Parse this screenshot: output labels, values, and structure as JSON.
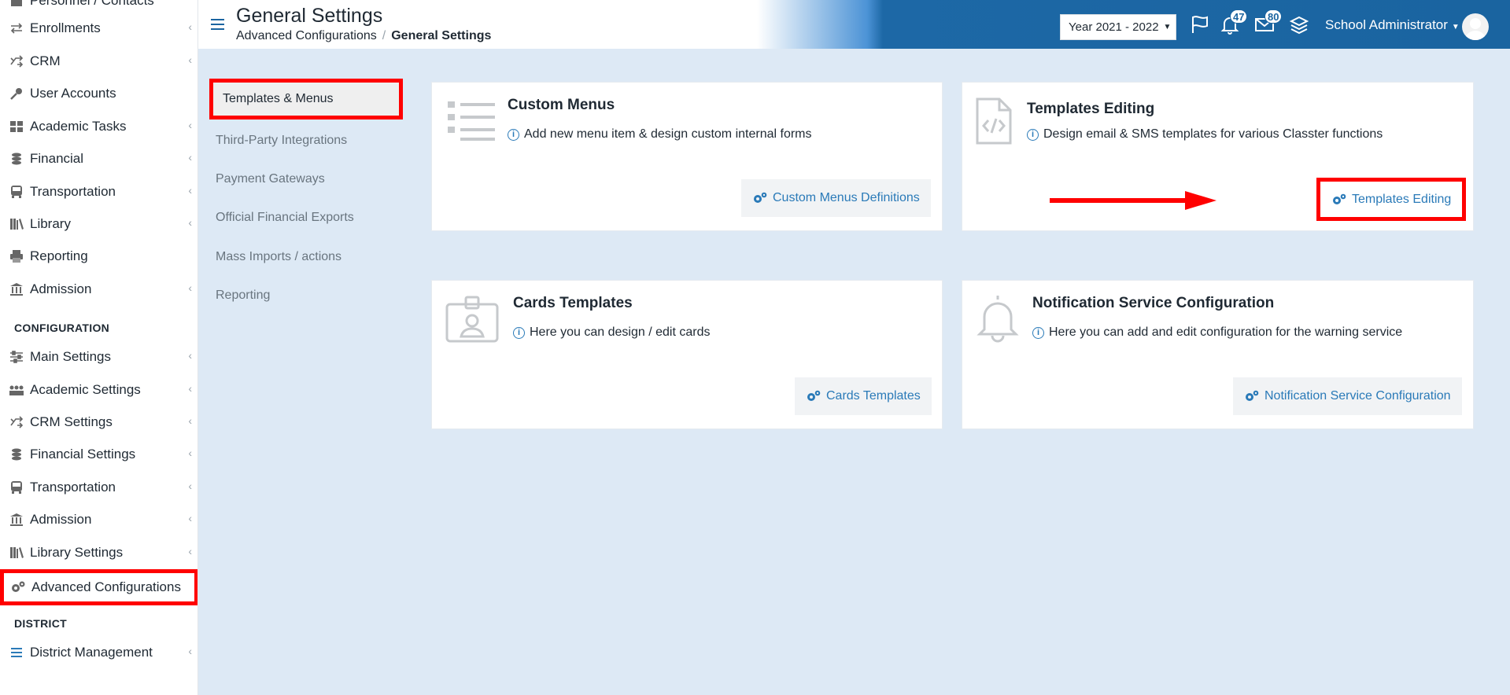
{
  "sidebar": {
    "top_partial": "Personnel / Contacts",
    "items": [
      {
        "label": "Enrollments",
        "icon": "arrows-icon"
      },
      {
        "label": "CRM",
        "icon": "shuffle-icon"
      },
      {
        "label": "User Accounts",
        "icon": "key-icon"
      },
      {
        "label": "Academic Tasks",
        "icon": "grid-icon"
      },
      {
        "label": "Financial",
        "icon": "coins-icon"
      },
      {
        "label": "Transportation",
        "icon": "bus-icon"
      },
      {
        "label": "Library",
        "icon": "books-icon"
      },
      {
        "label": "Reporting",
        "icon": "printer-icon"
      },
      {
        "label": "Admission",
        "icon": "institution-icon"
      }
    ],
    "config_heading": "CONFIGURATION",
    "config_items": [
      {
        "label": "Main Settings",
        "icon": "sliders-icon"
      },
      {
        "label": "Academic Settings",
        "icon": "people-icon"
      },
      {
        "label": "CRM Settings",
        "icon": "shuffle-icon"
      },
      {
        "label": "Financial Settings",
        "icon": "coins-icon"
      },
      {
        "label": "Transportation",
        "icon": "bus-icon"
      },
      {
        "label": "Admission",
        "icon": "institution-icon"
      },
      {
        "label": "Library Settings",
        "icon": "books-icon"
      },
      {
        "label": "Advanced Configurations",
        "icon": "gears-icon"
      }
    ],
    "district_heading": "DISTRICT",
    "district_items": [
      {
        "label": "District Management",
        "icon": "list-icon"
      }
    ]
  },
  "header": {
    "title": "General Settings",
    "breadcrumb": [
      "Advanced Configurations",
      "General Settings"
    ],
    "year": "Year 2021 - 2022",
    "notifications": "47",
    "messages": "80",
    "user": "School Administrator"
  },
  "settings_nav": {
    "active": "Templates & Menus",
    "items": [
      "Third-Party Integrations",
      "Payment Gateways",
      "Official Financial Exports",
      "Mass Imports / actions",
      "Reporting"
    ]
  },
  "cards": [
    {
      "title": "Custom Menus",
      "desc": "Add new menu item & design custom internal forms",
      "button": "Custom Menus Definitions",
      "icon": "list-icon"
    },
    {
      "title": "Templates Editing",
      "desc": "Design email & SMS templates for various Classter functions",
      "button": "Templates Editing",
      "icon": "code-file-icon"
    },
    {
      "title": "Cards Templates",
      "desc": "Here you can design / edit cards",
      "button": "Cards Templates",
      "icon": "id-card-icon"
    },
    {
      "title": "Notification Service Configuration",
      "desc": "Here you can add and edit configuration for the warning service",
      "button": "Notification Service Configuration",
      "icon": "bell-icon"
    }
  ],
  "colors": {
    "accent": "#2a7ab8",
    "highlight": "#ff0000",
    "header": "#1a64a0",
    "background": "#dde9f5"
  }
}
